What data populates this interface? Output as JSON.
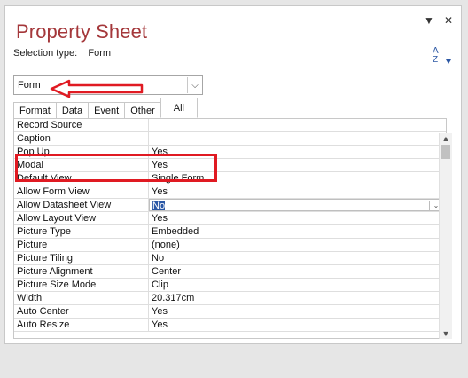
{
  "pane": {
    "title": "Property Sheet",
    "selection_type_label": "Selection type:",
    "selection_type_value": "Form",
    "combo_value": "Form",
    "combo_arrow": "⌵",
    "controls": {
      "dropdown": "▼",
      "close": "✕"
    },
    "sort_icon_text": "A\nZ"
  },
  "tabs": [
    {
      "label": "Format"
    },
    {
      "label": "Data"
    },
    {
      "label": "Event"
    },
    {
      "label": "Other"
    },
    {
      "label": "All",
      "active": true
    }
  ],
  "properties": [
    {
      "name": "Record Source",
      "value": ""
    },
    {
      "name": "Caption",
      "value": ""
    },
    {
      "name": "Pop Up",
      "value": "Yes"
    },
    {
      "name": "Modal",
      "value": "Yes"
    },
    {
      "name": "Default View",
      "value": "Single Form"
    },
    {
      "name": "Allow Form View",
      "value": "Yes"
    },
    {
      "name": "Allow Datasheet View",
      "value": "No",
      "selected": true
    },
    {
      "name": "Allow Layout View",
      "value": "Yes"
    },
    {
      "name": "Picture Type",
      "value": "Embedded"
    },
    {
      "name": "Picture",
      "value": "(none)"
    },
    {
      "name": "Picture Tiling",
      "value": "No"
    },
    {
      "name": "Picture Alignment",
      "value": "Center"
    },
    {
      "name": "Picture Size Mode",
      "value": "Clip"
    },
    {
      "name": "Width",
      "value": "20.317cm"
    },
    {
      "name": "Auto Center",
      "value": "Yes"
    },
    {
      "name": "Auto Resize",
      "value": "Yes"
    }
  ],
  "colors": {
    "title": "#a4373a",
    "annotation": "#e01a22",
    "selection_highlight": "#2b58a6"
  }
}
